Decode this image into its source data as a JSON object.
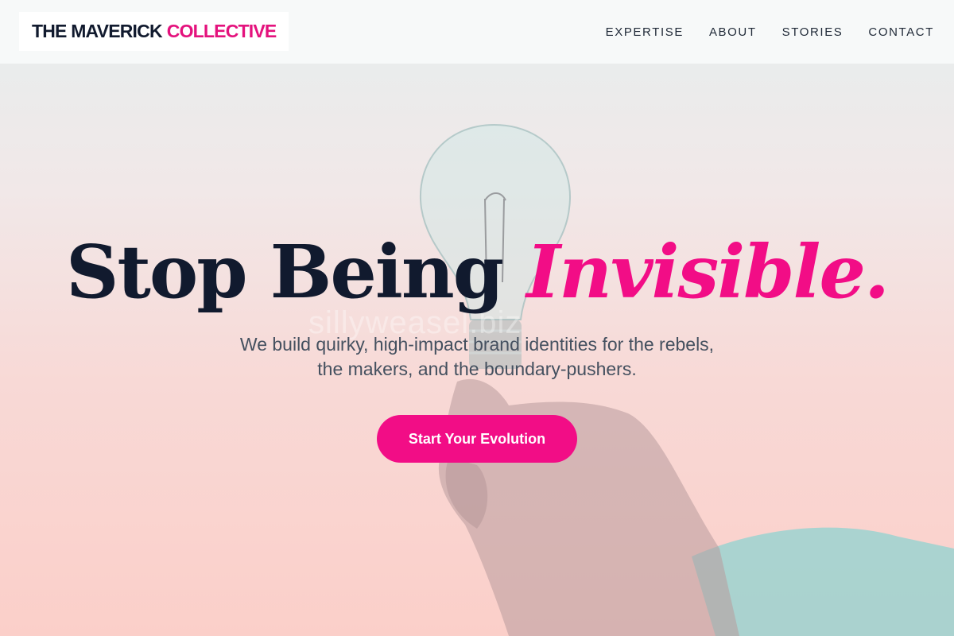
{
  "header": {
    "logo_main": "THE MAVERICK",
    "logo_accent": "COLLECTIVE",
    "nav": [
      {
        "label": "EXPERTISE"
      },
      {
        "label": "ABOUT"
      },
      {
        "label": "STORIES"
      },
      {
        "label": "CONTACT"
      }
    ]
  },
  "hero": {
    "headline_main": "Stop Being ",
    "headline_accent": "Invisible.",
    "subtitle": "We build quirky, high-impact brand identities for the rebels, the makers, and the boundary-pushers.",
    "cta_label": "Start Your Evolution",
    "watermark": "sillyweasel.biz",
    "image_subject": "hand-holding-lightbulb"
  },
  "colors": {
    "accent": "#f20d86",
    "text_dark": "#111a2e",
    "text_muted": "#44505f",
    "header_bg": "#f7f9f9"
  }
}
